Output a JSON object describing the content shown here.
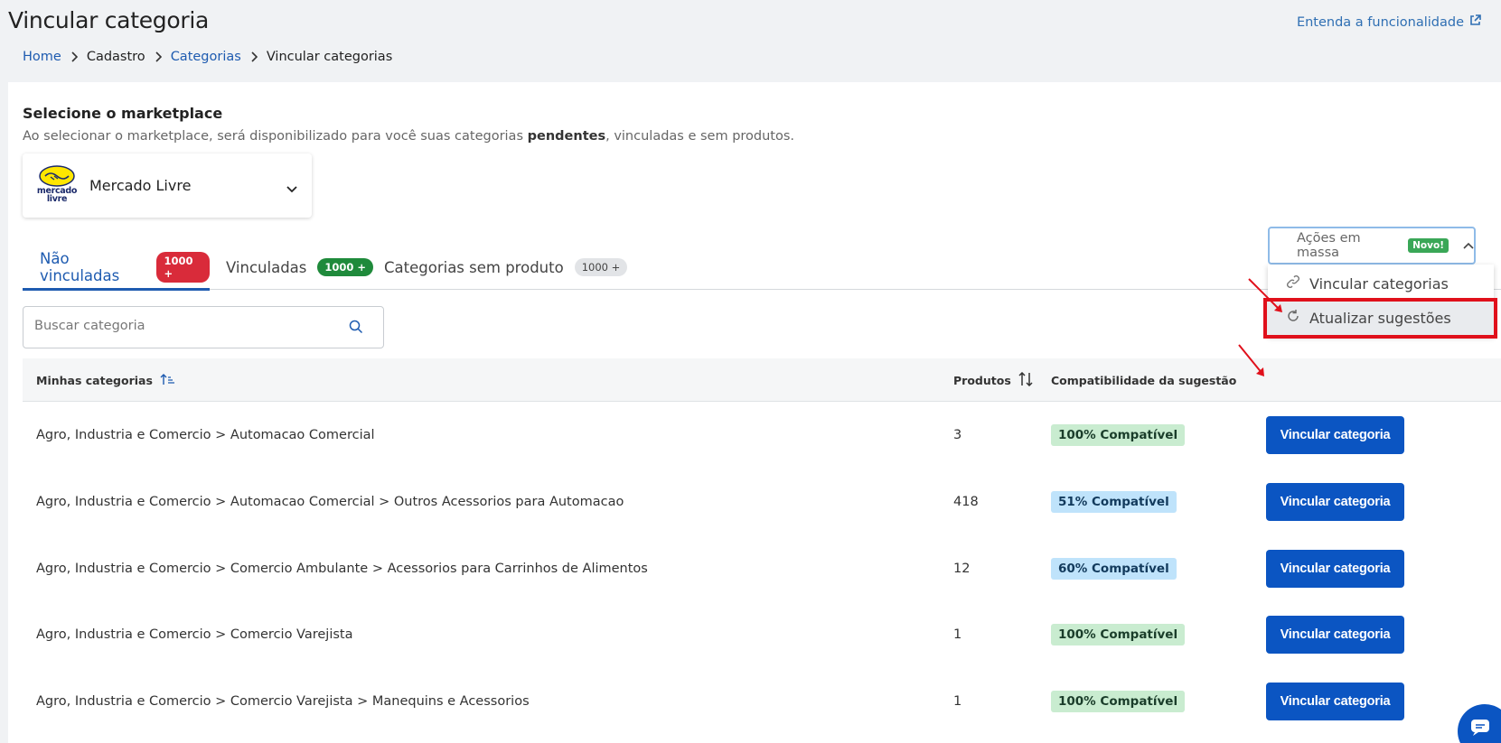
{
  "header": {
    "title": "Vincular categoria",
    "help_link": "Entenda a funcionalidade"
  },
  "breadcrumb": [
    {
      "label": "Home",
      "link": true
    },
    {
      "label": "Cadastro",
      "link": false
    },
    {
      "label": "Categorias",
      "link": true
    },
    {
      "label": "Vincular categorias",
      "link": false
    }
  ],
  "marketplace": {
    "title": "Selecione o marketplace",
    "desc_pre": "Ao selecionar o marketplace, será disponibilizado para você suas categorias ",
    "desc_bold": "pendentes",
    "desc_post": ", vinculadas e sem produtos.",
    "logo_text_1": "mercado",
    "logo_text_2": "livre",
    "selected": "Mercado Livre"
  },
  "tabs": [
    {
      "label": "Não vinculadas",
      "badge": "1000 +",
      "badge_color": "#d92b3a"
    },
    {
      "label": "Vinculadas",
      "badge": "1000 +",
      "badge_color": "#1f8a3b"
    },
    {
      "label": "Categorias sem produto",
      "badge": "1000 +",
      "badge_color": "#e2e4e7"
    }
  ],
  "search": {
    "placeholder": "Buscar categoria"
  },
  "mass_actions": {
    "label": "Ações em massa",
    "badge": "Novo!",
    "items": [
      "Vincular categorias",
      "Atualizar sugestões"
    ]
  },
  "table": {
    "headers": {
      "category": "Minhas categorias",
      "products": "Produtos",
      "compat": "Compatibilidade da sugestão"
    },
    "rows": [
      {
        "category": "Agro, Industria e Comercio > Automacao Comercial",
        "products": "3",
        "compat": "100% Compatível",
        "level": "high",
        "action": "Vincular categoria"
      },
      {
        "category": "Agro, Industria e Comercio > Automacao Comercial > Outros Acessorios para Automacao",
        "products": "418",
        "compat": "51% Compatível",
        "level": "mid",
        "action": "Vincular categoria"
      },
      {
        "category": "Agro, Industria e Comercio > Comercio Ambulante > Acessorios para Carrinhos de Alimentos",
        "products": "12",
        "compat": "60% Compatível",
        "level": "mid",
        "action": "Vincular categoria"
      },
      {
        "category": "Agro, Industria e Comercio > Comercio Varejista",
        "products": "1",
        "compat": "100% Compatível",
        "level": "high",
        "action": "Vincular categoria"
      },
      {
        "category": "Agro, Industria e Comercio > Comercio Varejista > Manequins e Acessorios",
        "products": "1",
        "compat": "100% Compatível",
        "level": "high",
        "action": "Vincular categoria"
      }
    ]
  },
  "colors": {
    "primary": "#0b55c2",
    "link": "#1e5bb0",
    "highlight": "#e0101b",
    "compat_high": "#c9ecd0",
    "compat_mid": "#bfe3fb"
  }
}
